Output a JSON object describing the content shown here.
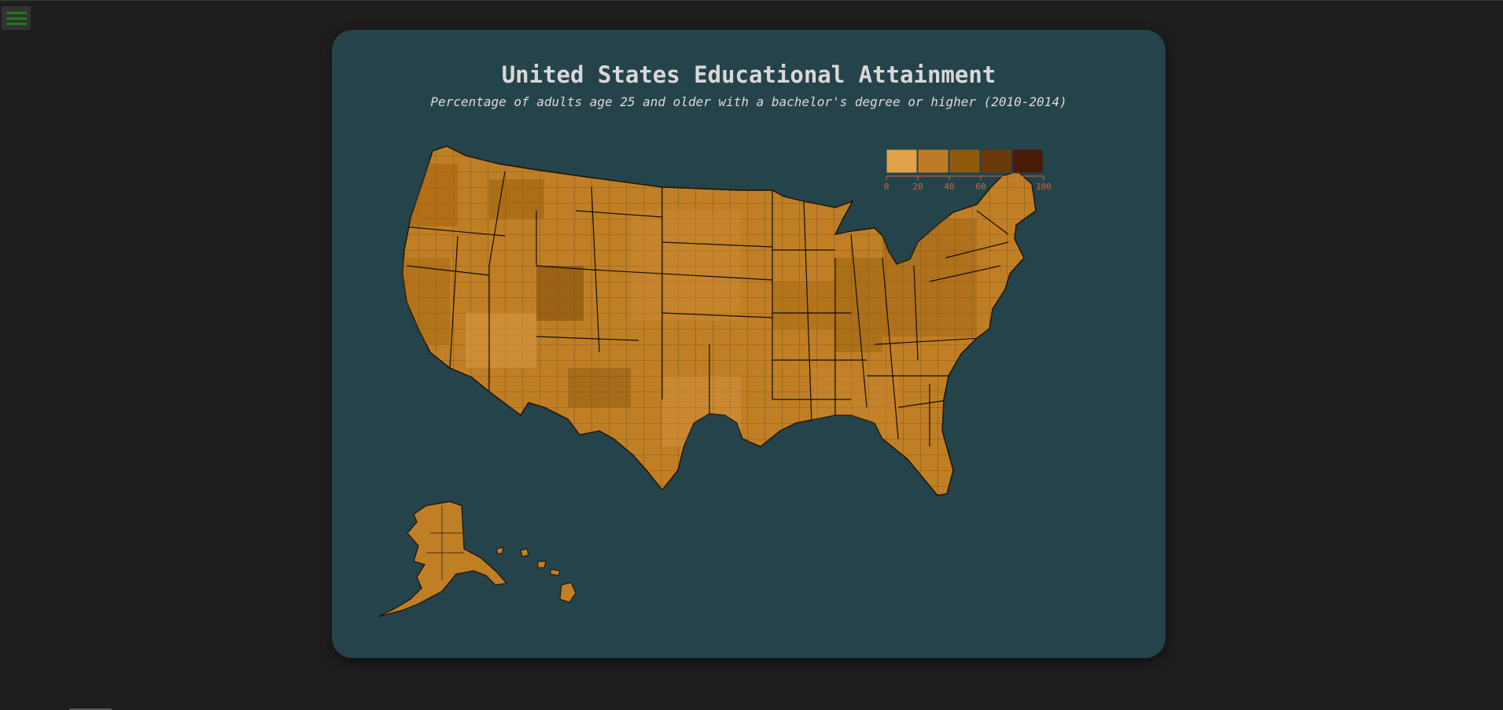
{
  "header": {
    "title": "United States Educational Attainment",
    "subtitle": "Percentage of adults age 25 and older with a bachelor's degree or higher (2010-2014)"
  },
  "menu": {
    "icon": "hamburger-menu-icon"
  },
  "legend": {
    "ticks": [
      "0",
      "20",
      "40",
      "60",
      "80",
      "100"
    ],
    "colors": [
      "#e0a148",
      "#bd7a25",
      "#8f5a0b",
      "#6b3a0a",
      "#4a1a08"
    ],
    "tick_color": "#c86a3a"
  },
  "colors": {
    "page_bg": "#1e1e1e",
    "card_bg": "#25434a",
    "land_base": "#c07f25",
    "border": "#1a1208"
  }
}
